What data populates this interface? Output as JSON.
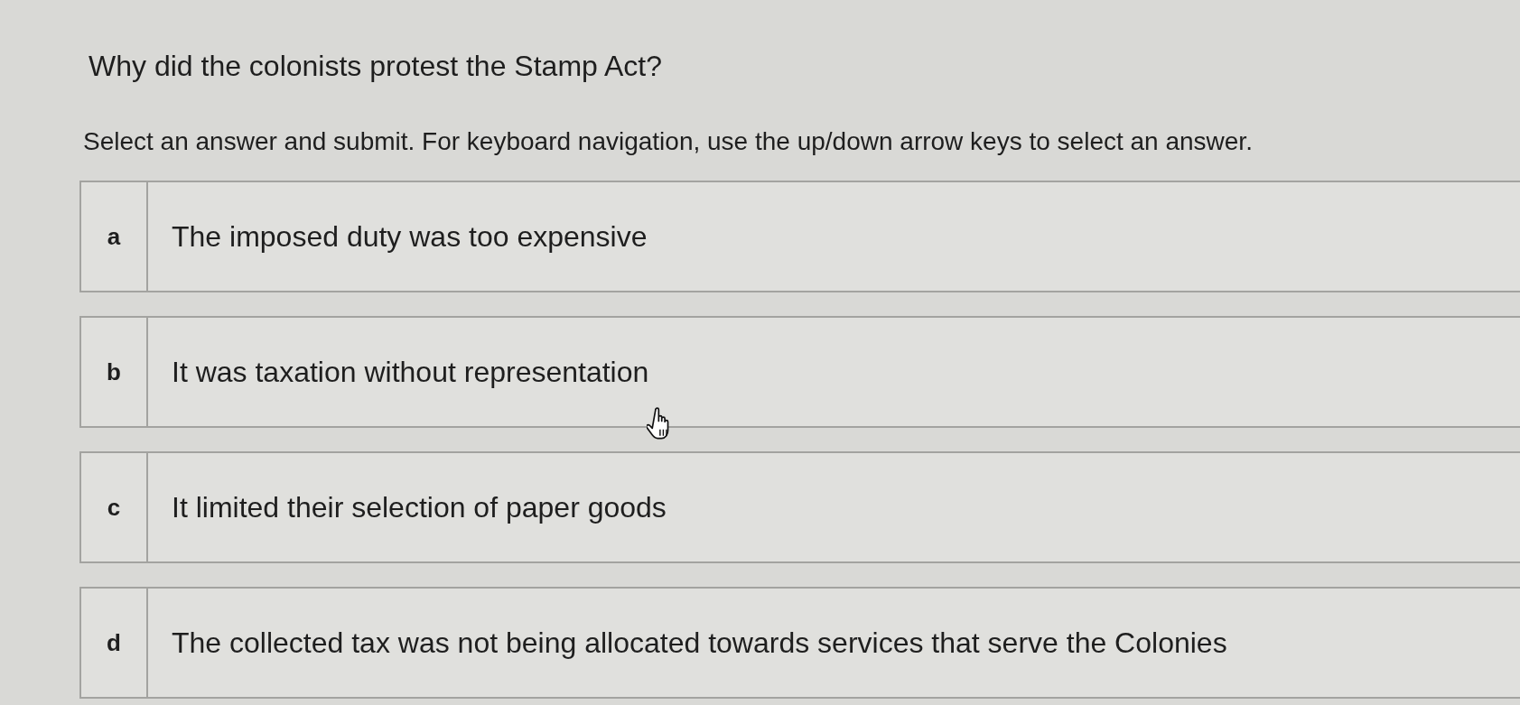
{
  "question": "Why did the colonists protest the Stamp Act?",
  "instructions": "Select an answer and submit. For keyboard navigation, use the up/down arrow keys to select an answer.",
  "options": [
    {
      "letter": "a",
      "text": "The imposed duty was too expensive"
    },
    {
      "letter": "b",
      "text": "It was taxation without representation"
    },
    {
      "letter": "c",
      "text": "It limited their selection of paper goods"
    },
    {
      "letter": "d",
      "text": "The collected tax was not being allocated towards services that serve the Colonies"
    }
  ]
}
